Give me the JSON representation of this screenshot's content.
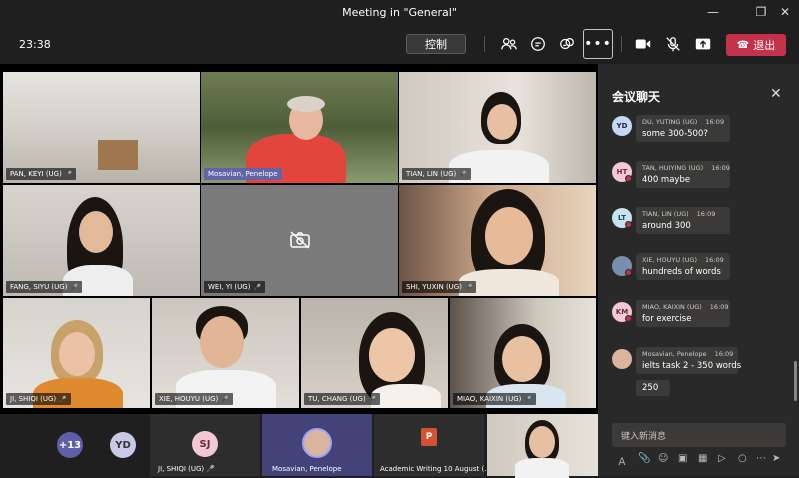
{
  "window": {
    "title": "Meeting in \"General\""
  },
  "toolbar": {
    "time": "23:38",
    "control_label": "控制",
    "leave_label": "退出",
    "more_label": "•••"
  },
  "tiles": [
    {
      "name": "PAN, KEYI (UG)"
    },
    {
      "name": "Mosavian, Penelope"
    },
    {
      "name": "TIAN, LIN (UG)"
    },
    {
      "name": "FANG, SIYU (UG)"
    },
    {
      "name": "WEI, YI (UG)"
    },
    {
      "name": "SHI, YUXIN (UG)"
    },
    {
      "name": "JI, SHIQI (UG)"
    },
    {
      "name": "XIE, HOUYU (UG)"
    },
    {
      "name": "TU, CHANG (UG)"
    },
    {
      "name": "MIAO, KAIXIN (UG)"
    }
  ],
  "bottom": {
    "overflow_count": "+13",
    "yd_initials": "YD",
    "sj_initials": "SJ",
    "sj_name": "JI, SHIQI (UG)",
    "presenter_name": "Mosavian, Penelope",
    "ppt_title": "Academic Writing 10 August (..."
  },
  "chat": {
    "title": "会议聊天",
    "placeholder": "键入新消息",
    "messages": [
      {
        "initials": "YD",
        "author": "DU, YUTING (UG)",
        "time": "16:09",
        "text": "some 300-500?"
      },
      {
        "initials": "HT",
        "author": "TAN, HUIYING (UG)",
        "time": "16:09",
        "text": "400 maybe"
      },
      {
        "initials": "LT",
        "author": "TIAN, LIN (UG)",
        "time": "16:09",
        "text": "around 300"
      },
      {
        "initials": "",
        "author": "XIE, HOUYU (UG)",
        "time": "16:09",
        "text": "hundreds of words"
      },
      {
        "initials": "KM",
        "author": "MIAO, KAIXIN (UG)",
        "time": "16:09",
        "text": "for exercise"
      },
      {
        "initials": "",
        "author": "Mosavian, Penelope",
        "time": "16:09",
        "text": "ielts task 2 - 350 words",
        "text2": "250"
      }
    ]
  },
  "colors": {
    "accent": "#6264a7",
    "leave": "#c4314b",
    "panel": "#292929"
  }
}
